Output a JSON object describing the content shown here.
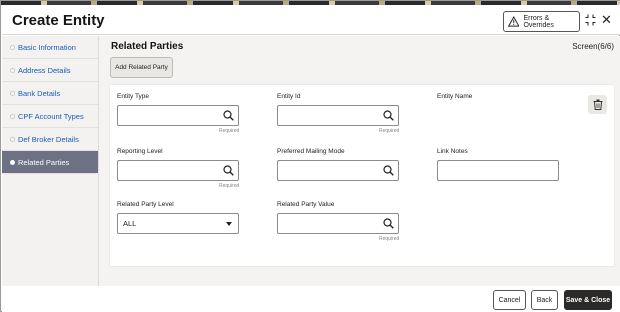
{
  "header": {
    "title": "Create Entity",
    "errors_label": "Errors & Overrides"
  },
  "sidebar": {
    "items": [
      {
        "label": "Basic Information"
      },
      {
        "label": "Address Details"
      },
      {
        "label": "Bank Details"
      },
      {
        "label": "CPF Account Types"
      },
      {
        "label": "Def Broker Details"
      },
      {
        "label": "Related Parties"
      }
    ]
  },
  "main": {
    "section_title": "Related Parties",
    "screen_counter": "Screen(6/6)",
    "add_button": "Add Related Party",
    "fields": {
      "entity_type": {
        "label": "Entity Type",
        "value": "",
        "required": "Required"
      },
      "entity_id": {
        "label": "Entity Id",
        "value": "",
        "required": "Required"
      },
      "entity_name": {
        "label": "Entity Name"
      },
      "reporting_level": {
        "label": "Reporting Level",
        "value": "",
        "required": "Required"
      },
      "preferred_mailing_mode": {
        "label": "Preferred Mailing Mode",
        "value": ""
      },
      "link_notes": {
        "label": "Link Notes",
        "value": ""
      },
      "related_party_level": {
        "label": "Related Party Level",
        "value": "ALL"
      },
      "related_party_value": {
        "label": "Related Party Value",
        "value": "",
        "required": "Required"
      }
    }
  },
  "footer": {
    "cancel": "Cancel",
    "back": "Back",
    "save_close": "Save & Close"
  },
  "colors": {
    "active_sidebar": "#6e7083",
    "link_blue": "#1b5bb5",
    "primary_button": "#2b2a28"
  }
}
